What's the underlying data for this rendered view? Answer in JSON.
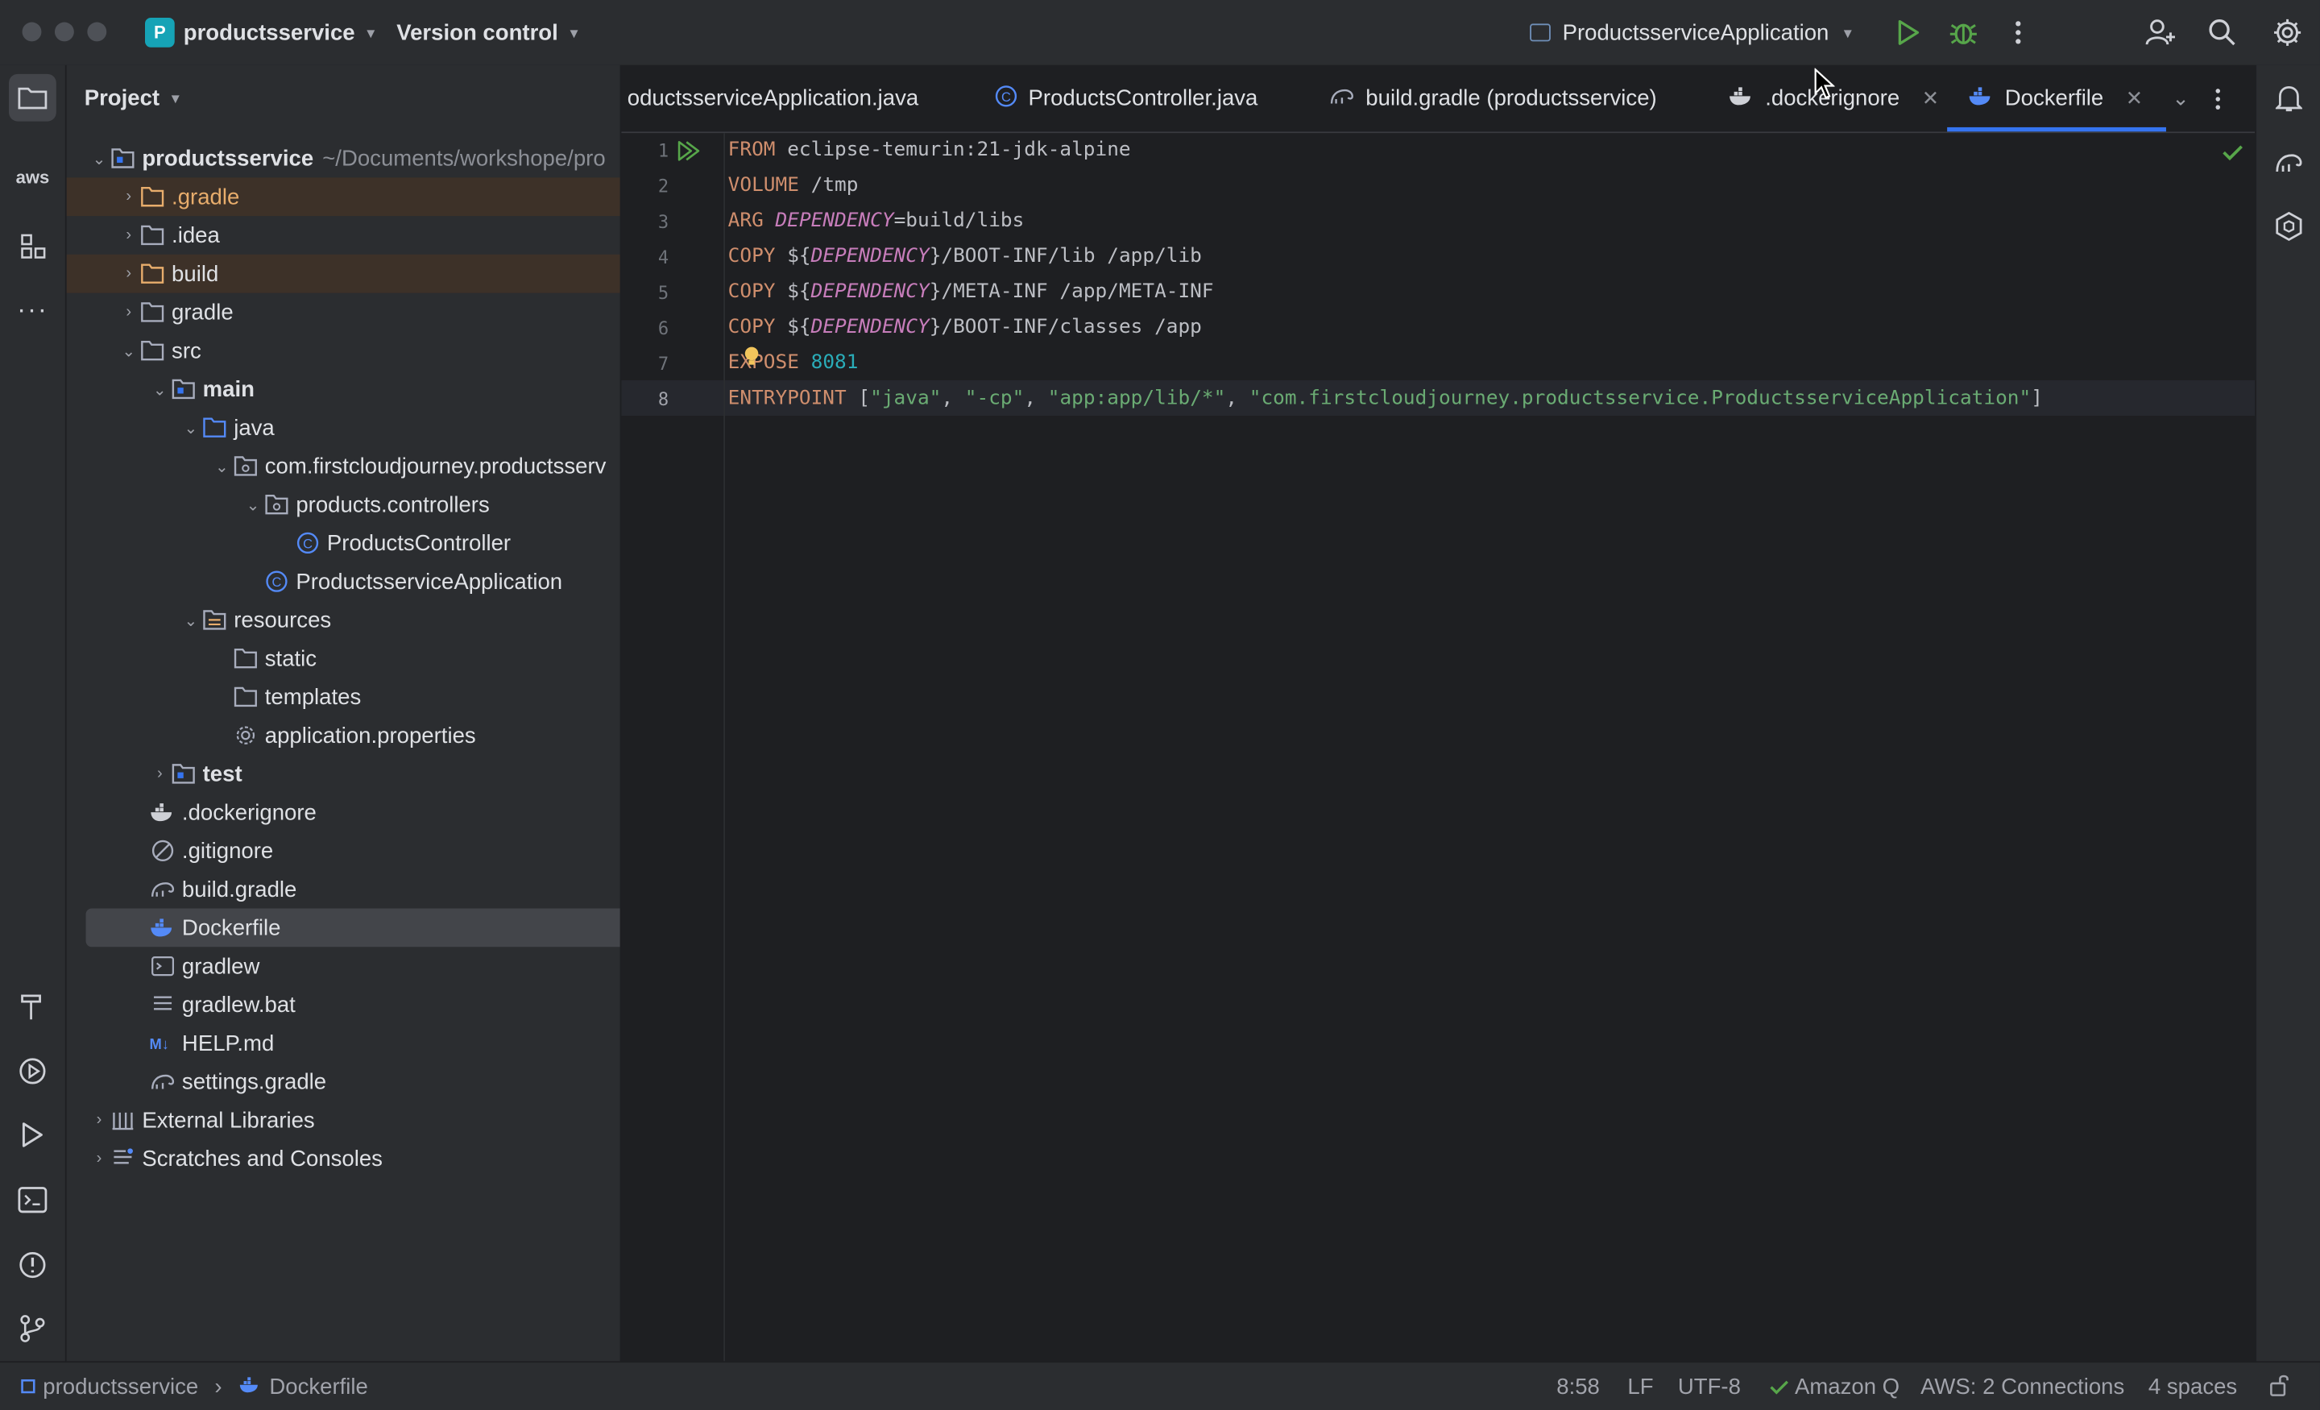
{
  "titlebar": {
    "project_badge": "P",
    "project_name": "productsservice",
    "vcs_label": "Version control",
    "run_config": "ProductsserviceApplication",
    "icons": [
      "run-icon",
      "debug-icon",
      "more-icon",
      "add-user-icon",
      "search-icon",
      "settings-icon"
    ]
  },
  "project_panel": {
    "title": "Project",
    "root": {
      "label": "productsservice",
      "path": "~/Documents/workshope/pro"
    },
    "items": [
      {
        "label": ".gradle"
      },
      {
        "label": ".idea"
      },
      {
        "label": "build"
      },
      {
        "label": "gradle"
      },
      {
        "label": "src"
      },
      {
        "label": "main"
      },
      {
        "label": "java"
      },
      {
        "label": "com.firstcloudjourney.productsserv"
      },
      {
        "label": "products.controllers"
      },
      {
        "label": "ProductsController"
      },
      {
        "label": "ProductsserviceApplication"
      },
      {
        "label": "resources"
      },
      {
        "label": "static"
      },
      {
        "label": "templates"
      },
      {
        "label": "application.properties"
      },
      {
        "label": "test"
      },
      {
        "label": ".dockerignore"
      },
      {
        "label": ".gitignore"
      },
      {
        "label": "build.gradle"
      },
      {
        "label": "Dockerfile"
      },
      {
        "label": "gradlew"
      },
      {
        "label": "gradlew.bat"
      },
      {
        "label": "HELP.md"
      },
      {
        "label": "settings.gradle"
      },
      {
        "label": "External Libraries"
      },
      {
        "label": "Scratches and Consoles"
      }
    ]
  },
  "tabs": [
    {
      "label": "oductsserviceApplication.java"
    },
    {
      "label": "ProductsController.java"
    },
    {
      "label": "build.gradle (productsservice)"
    },
    {
      "label": ".dockerignore"
    },
    {
      "label": "Dockerfile"
    }
  ],
  "editor": {
    "line_numbers": [
      "1",
      "2",
      "3",
      "4",
      "5",
      "6",
      "7",
      "8"
    ],
    "lines": {
      "l1": {
        "kw": "FROM",
        "rest": " eclipse-temurin:21-jdk-alpine"
      },
      "l2": {
        "kw": "VOLUME",
        "rest": " /tmp"
      },
      "l3": {
        "kw": "ARG",
        "var": "DEPENDENCY",
        "rest": "=build/libs"
      },
      "l4": {
        "kw": "COPY",
        "pre": " ${",
        "var": "DEPENDENCY",
        "rest": "}/BOOT-INF/lib /app/lib"
      },
      "l5": {
        "kw": "COPY",
        "pre": " ${",
        "var": "DEPENDENCY",
        "rest": "}/META-INF /app/META-INF"
      },
      "l6": {
        "kw": "COPY",
        "pre": " ${",
        "var": "DEPENDENCY",
        "rest": "}/BOOT-INF/classes /app"
      },
      "l7": {
        "kw": "EXPOSE",
        "num": "8081"
      },
      "l8": {
        "kw": "ENTRYPOINT",
        "open": " [",
        "s1": "\"java\"",
        "s2": "\"-cp\"",
        "s3": "\"app:app/lib/*\"",
        "s4": "\"com.firstcloudjourney.productsservice.ProductsserviceApplication\"",
        "sep": ", ",
        "close": "]"
      }
    }
  },
  "statusbar": {
    "breadcrumb_project": "productsservice",
    "breadcrumb_sep": "›",
    "breadcrumb_file": "Dockerfile",
    "position": "8:58",
    "line_ending": "LF",
    "encoding": "UTF-8",
    "amazon_q": "Amazon Q",
    "aws": "AWS: 2 Connections",
    "indent": "4 spaces"
  },
  "colors": {
    "accent": "#3574f0",
    "excluded_bg": "#3d3128",
    "excluded_text": "#e8ad6c",
    "keyword": "#cf8e6d",
    "string": "#6aab73",
    "variable": "#c77dbb",
    "number": "#2aacb8"
  }
}
